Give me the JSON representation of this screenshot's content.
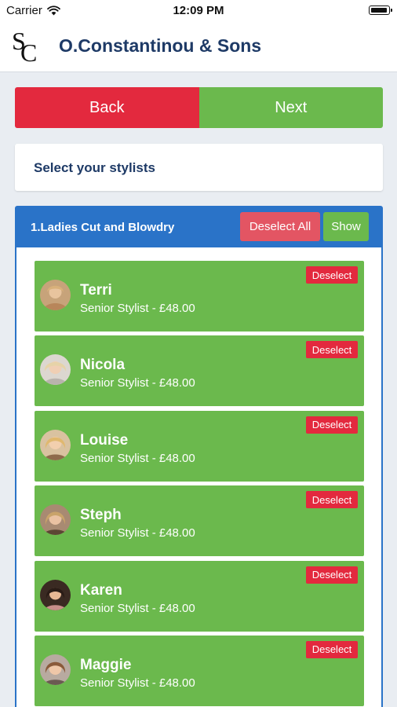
{
  "status_bar": {
    "carrier": "Carrier",
    "time": "12:09 PM",
    "wifi_icon": "wifi-icon",
    "battery_icon": "battery-icon"
  },
  "header": {
    "logo": "SC",
    "title": "O.Constantinou & Sons"
  },
  "nav": {
    "back_label": "Back",
    "next_label": "Next",
    "back_color": "#e3293e",
    "next_color": "#6bb94d"
  },
  "prompt": {
    "text": "Select your stylists"
  },
  "service": {
    "title": "1.Ladies Cut and Blowdry",
    "deselect_all_label": "Deselect All",
    "show_label": "Show",
    "header_color": "#2a73c8",
    "stylists": [
      {
        "name": "Terri",
        "role": "Senior Stylist - £48.00",
        "deselect_label": "Deselect"
      },
      {
        "name": "Nicola",
        "role": "Senior Stylist - £48.00",
        "deselect_label": "Deselect"
      },
      {
        "name": "Louise",
        "role": "Senior Stylist - £48.00",
        "deselect_label": "Deselect"
      },
      {
        "name": "Steph",
        "role": "Senior Stylist - £48.00",
        "deselect_label": "Deselect"
      },
      {
        "name": "Karen",
        "role": "Senior Stylist - £48.00",
        "deselect_label": "Deselect"
      },
      {
        "name": "Maggie",
        "role": "Senior Stylist - £48.00",
        "deselect_label": "Deselect"
      }
    ]
  }
}
